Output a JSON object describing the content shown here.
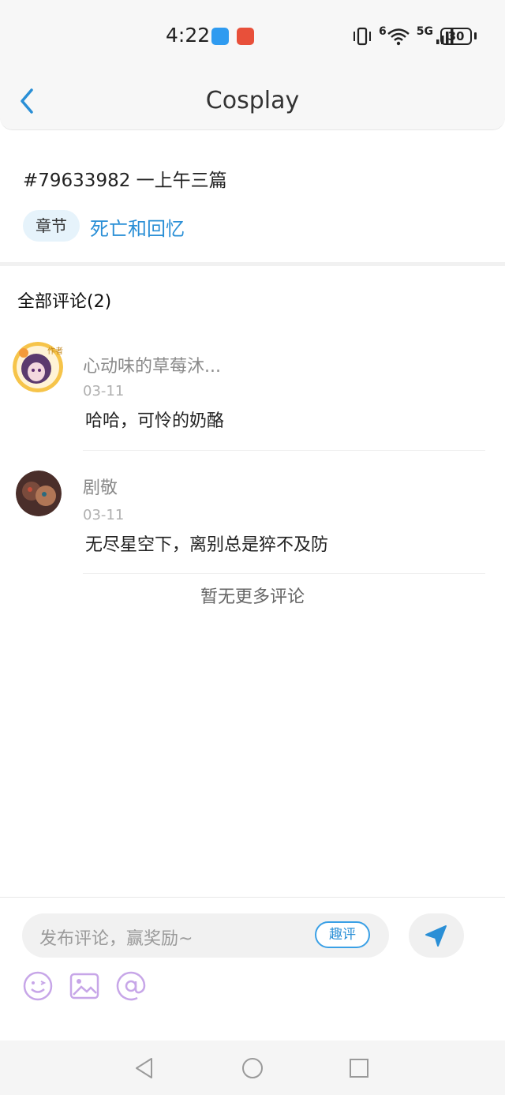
{
  "status_bar": {
    "time": "4:22",
    "network": "5G",
    "wifi_badge": "6",
    "battery": "30"
  },
  "header": {
    "title": "Cosplay"
  },
  "post": {
    "id_title": "#79633982 一上午三篇",
    "chapter_chip": "章节",
    "chapter_name": "死亡和回忆"
  },
  "comments_section": {
    "title": "全部评论(2)",
    "items": [
      {
        "name": "心动味的草莓沐...",
        "date": "03-11",
        "text": "哈哈，可怜的奶酪",
        "badge": "作者"
      },
      {
        "name": "剧敬",
        "date": "03-11",
        "text": "无尽星空下，离别总是猝不及防"
      }
    ],
    "no_more": "暂无更多评论"
  },
  "composer": {
    "placeholder": "发布评论，赢奖励~",
    "quping_label": "趣评"
  },
  "colors": {
    "accent": "#2a8fd6",
    "chip_bg": "#e6f3fb",
    "tool_icon": "#c7a6e8"
  },
  "icons": {
    "back": "chevron-left-icon",
    "send": "paper-plane-icon",
    "emoji": "emoji-icon",
    "image": "image-icon",
    "mention": "at-icon"
  }
}
